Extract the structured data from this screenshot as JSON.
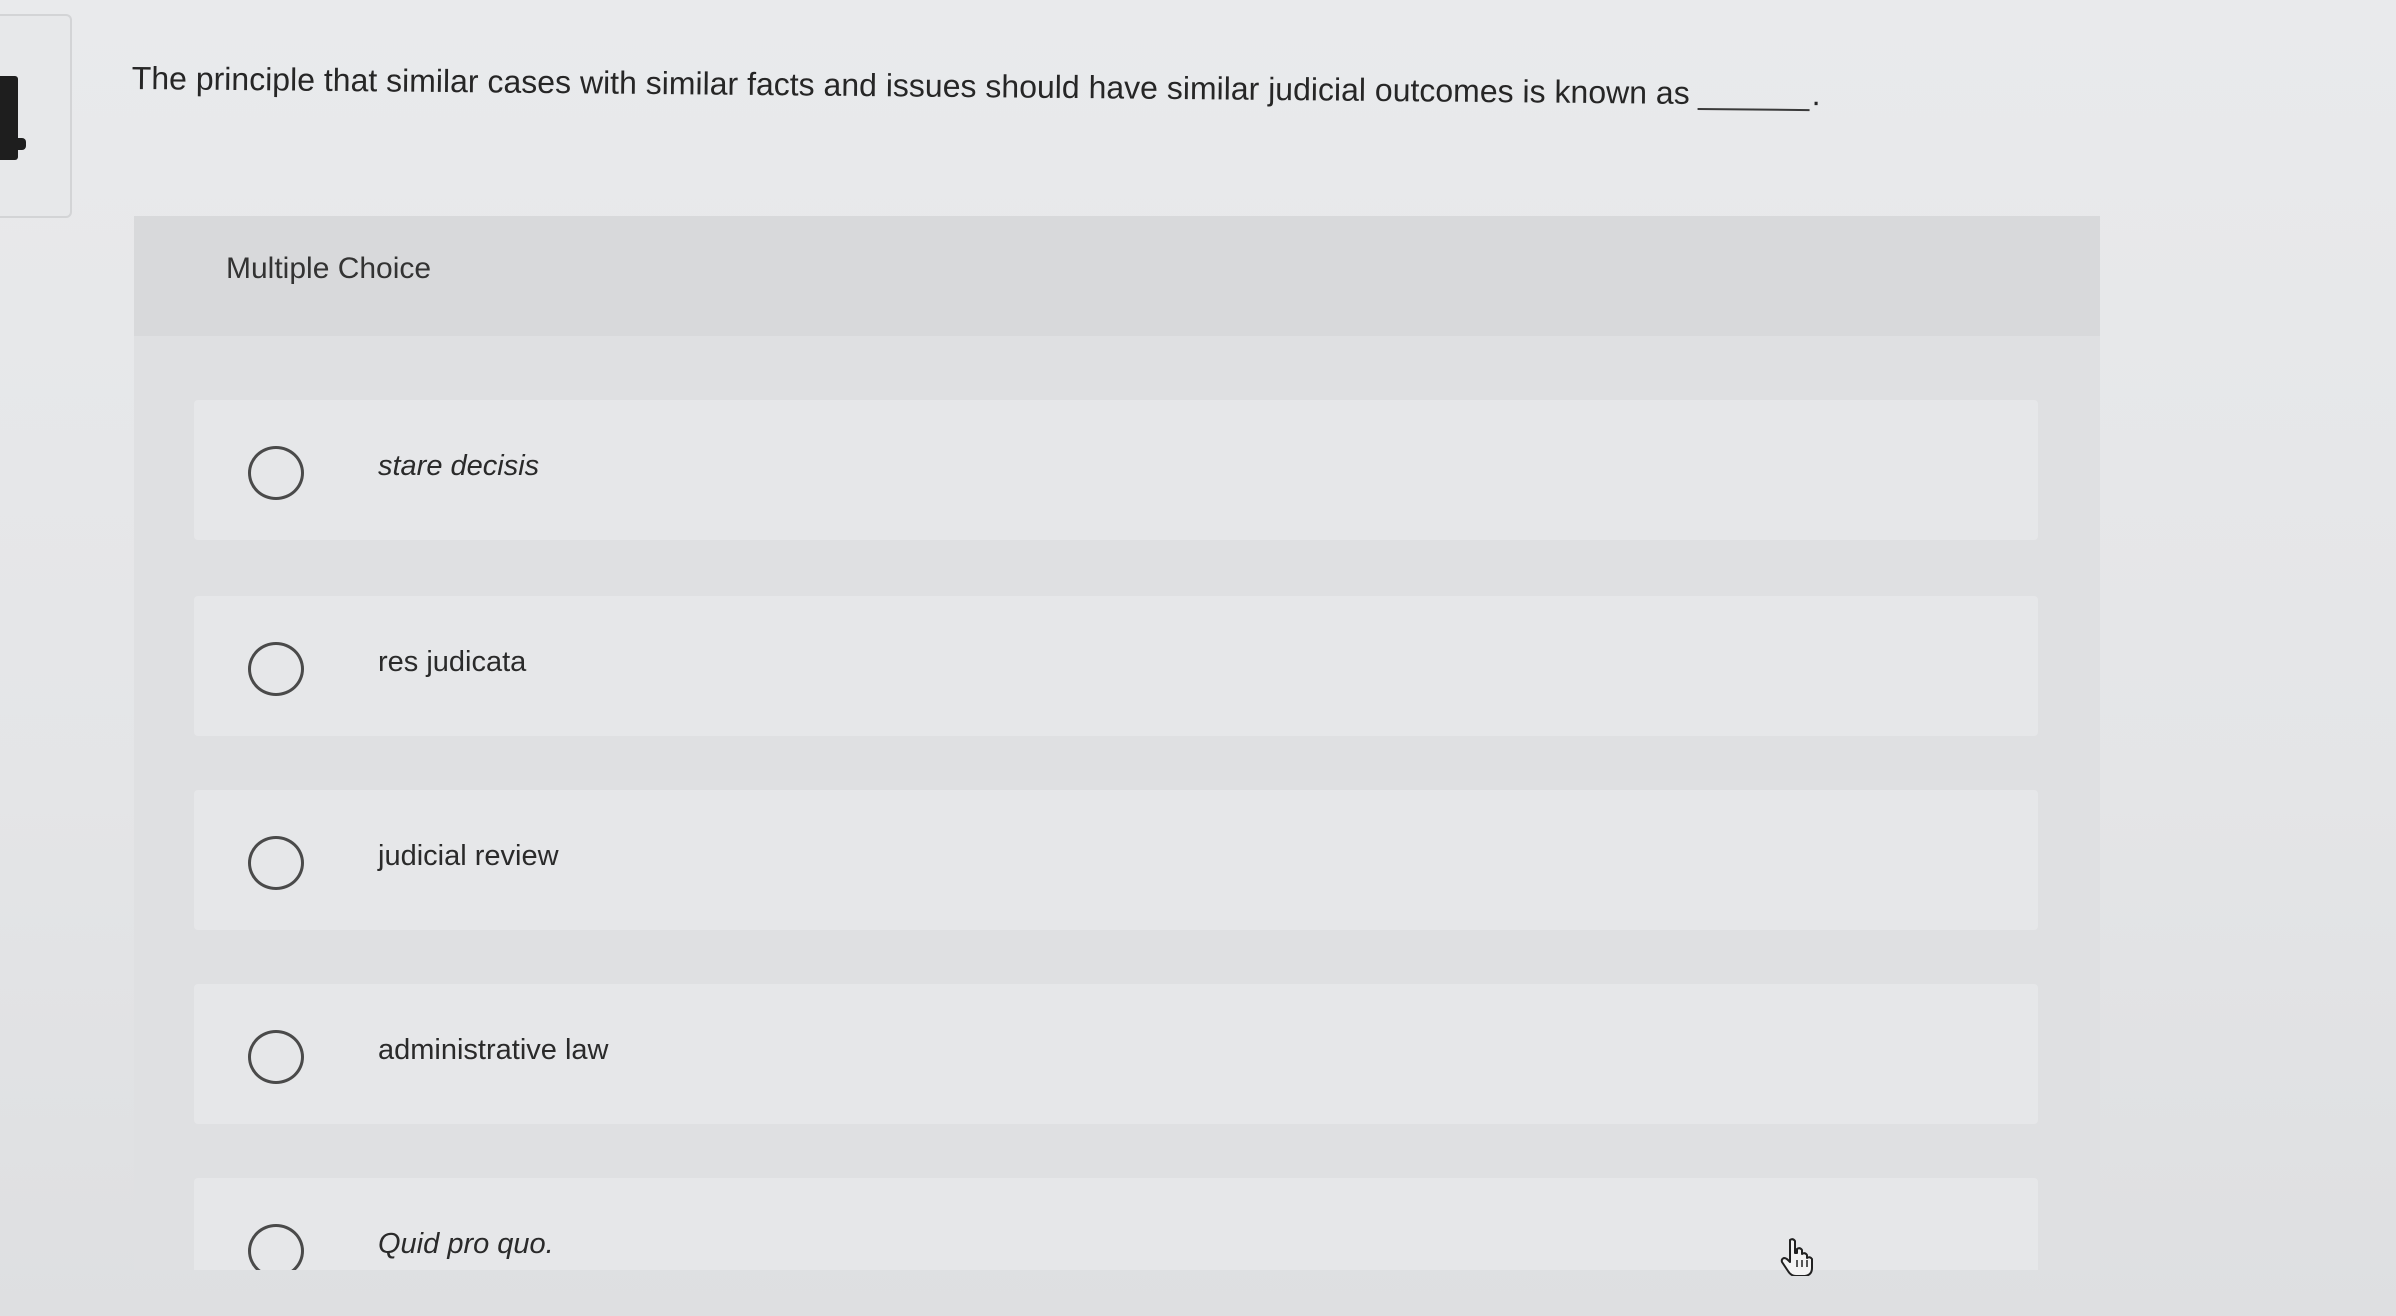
{
  "question": {
    "text": "The principle that similar cases with similar facts and issues should have similar judicial outcomes is known as",
    "blank_suffix": "."
  },
  "multiple_choice": {
    "header_label": "Multiple Choice",
    "options": [
      {
        "label": "stare decisis",
        "italic": true,
        "selected": false
      },
      {
        "label": "res judicata",
        "italic": false,
        "selected": false
      },
      {
        "label": "judicial review",
        "italic": false,
        "selected": false
      },
      {
        "label": "administrative law",
        "italic": false,
        "selected": false
      },
      {
        "label": "Quid pro quo.",
        "italic": true,
        "selected": false
      }
    ]
  },
  "icons": {
    "radio": "radio-button-icon",
    "cursor": "hand-pointer-icon"
  },
  "colors": {
    "background": "#e6e7e9",
    "panel": "#dfe0e2",
    "header": "#d8d9db",
    "text": "#2b2b2b"
  }
}
